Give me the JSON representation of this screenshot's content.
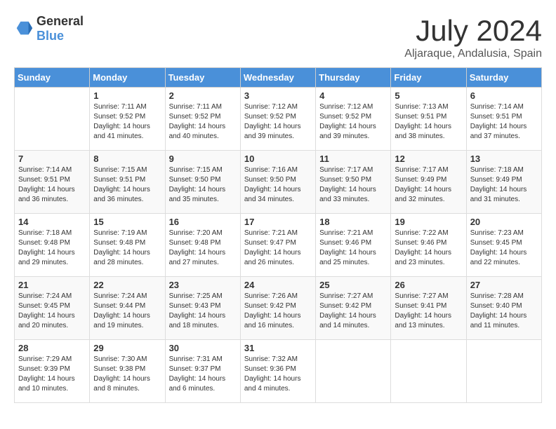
{
  "header": {
    "logo_general": "General",
    "logo_blue": "Blue",
    "month": "July 2024",
    "location": "Aljaraque, Andalusia, Spain"
  },
  "days_of_week": [
    "Sunday",
    "Monday",
    "Tuesday",
    "Wednesday",
    "Thursday",
    "Friday",
    "Saturday"
  ],
  "weeks": [
    [
      {
        "day": "",
        "sunrise": "",
        "sunset": "",
        "daylight": ""
      },
      {
        "day": "1",
        "sunrise": "Sunrise: 7:11 AM",
        "sunset": "Sunset: 9:52 PM",
        "daylight": "Daylight: 14 hours and 41 minutes."
      },
      {
        "day": "2",
        "sunrise": "Sunrise: 7:11 AM",
        "sunset": "Sunset: 9:52 PM",
        "daylight": "Daylight: 14 hours and 40 minutes."
      },
      {
        "day": "3",
        "sunrise": "Sunrise: 7:12 AM",
        "sunset": "Sunset: 9:52 PM",
        "daylight": "Daylight: 14 hours and 39 minutes."
      },
      {
        "day": "4",
        "sunrise": "Sunrise: 7:12 AM",
        "sunset": "Sunset: 9:52 PM",
        "daylight": "Daylight: 14 hours and 39 minutes."
      },
      {
        "day": "5",
        "sunrise": "Sunrise: 7:13 AM",
        "sunset": "Sunset: 9:51 PM",
        "daylight": "Daylight: 14 hours and 38 minutes."
      },
      {
        "day": "6",
        "sunrise": "Sunrise: 7:14 AM",
        "sunset": "Sunset: 9:51 PM",
        "daylight": "Daylight: 14 hours and 37 minutes."
      }
    ],
    [
      {
        "day": "7",
        "sunrise": "Sunrise: 7:14 AM",
        "sunset": "Sunset: 9:51 PM",
        "daylight": "Daylight: 14 hours and 36 minutes."
      },
      {
        "day": "8",
        "sunrise": "Sunrise: 7:15 AM",
        "sunset": "Sunset: 9:51 PM",
        "daylight": "Daylight: 14 hours and 36 minutes."
      },
      {
        "day": "9",
        "sunrise": "Sunrise: 7:15 AM",
        "sunset": "Sunset: 9:50 PM",
        "daylight": "Daylight: 14 hours and 35 minutes."
      },
      {
        "day": "10",
        "sunrise": "Sunrise: 7:16 AM",
        "sunset": "Sunset: 9:50 PM",
        "daylight": "Daylight: 14 hours and 34 minutes."
      },
      {
        "day": "11",
        "sunrise": "Sunrise: 7:17 AM",
        "sunset": "Sunset: 9:50 PM",
        "daylight": "Daylight: 14 hours and 33 minutes."
      },
      {
        "day": "12",
        "sunrise": "Sunrise: 7:17 AM",
        "sunset": "Sunset: 9:49 PM",
        "daylight": "Daylight: 14 hours and 32 minutes."
      },
      {
        "day": "13",
        "sunrise": "Sunrise: 7:18 AM",
        "sunset": "Sunset: 9:49 PM",
        "daylight": "Daylight: 14 hours and 31 minutes."
      }
    ],
    [
      {
        "day": "14",
        "sunrise": "Sunrise: 7:18 AM",
        "sunset": "Sunset: 9:48 PM",
        "daylight": "Daylight: 14 hours and 29 minutes."
      },
      {
        "day": "15",
        "sunrise": "Sunrise: 7:19 AM",
        "sunset": "Sunset: 9:48 PM",
        "daylight": "Daylight: 14 hours and 28 minutes."
      },
      {
        "day": "16",
        "sunrise": "Sunrise: 7:20 AM",
        "sunset": "Sunset: 9:48 PM",
        "daylight": "Daylight: 14 hours and 27 minutes."
      },
      {
        "day": "17",
        "sunrise": "Sunrise: 7:21 AM",
        "sunset": "Sunset: 9:47 PM",
        "daylight": "Daylight: 14 hours and 26 minutes."
      },
      {
        "day": "18",
        "sunrise": "Sunrise: 7:21 AM",
        "sunset": "Sunset: 9:46 PM",
        "daylight": "Daylight: 14 hours and 25 minutes."
      },
      {
        "day": "19",
        "sunrise": "Sunrise: 7:22 AM",
        "sunset": "Sunset: 9:46 PM",
        "daylight": "Daylight: 14 hours and 23 minutes."
      },
      {
        "day": "20",
        "sunrise": "Sunrise: 7:23 AM",
        "sunset": "Sunset: 9:45 PM",
        "daylight": "Daylight: 14 hours and 22 minutes."
      }
    ],
    [
      {
        "day": "21",
        "sunrise": "Sunrise: 7:24 AM",
        "sunset": "Sunset: 9:45 PM",
        "daylight": "Daylight: 14 hours and 20 minutes."
      },
      {
        "day": "22",
        "sunrise": "Sunrise: 7:24 AM",
        "sunset": "Sunset: 9:44 PM",
        "daylight": "Daylight: 14 hours and 19 minutes."
      },
      {
        "day": "23",
        "sunrise": "Sunrise: 7:25 AM",
        "sunset": "Sunset: 9:43 PM",
        "daylight": "Daylight: 14 hours and 18 minutes."
      },
      {
        "day": "24",
        "sunrise": "Sunrise: 7:26 AM",
        "sunset": "Sunset: 9:42 PM",
        "daylight": "Daylight: 14 hours and 16 minutes."
      },
      {
        "day": "25",
        "sunrise": "Sunrise: 7:27 AM",
        "sunset": "Sunset: 9:42 PM",
        "daylight": "Daylight: 14 hours and 14 minutes."
      },
      {
        "day": "26",
        "sunrise": "Sunrise: 7:27 AM",
        "sunset": "Sunset: 9:41 PM",
        "daylight": "Daylight: 14 hours and 13 minutes."
      },
      {
        "day": "27",
        "sunrise": "Sunrise: 7:28 AM",
        "sunset": "Sunset: 9:40 PM",
        "daylight": "Daylight: 14 hours and 11 minutes."
      }
    ],
    [
      {
        "day": "28",
        "sunrise": "Sunrise: 7:29 AM",
        "sunset": "Sunset: 9:39 PM",
        "daylight": "Daylight: 14 hours and 10 minutes."
      },
      {
        "day": "29",
        "sunrise": "Sunrise: 7:30 AM",
        "sunset": "Sunset: 9:38 PM",
        "daylight": "Daylight: 14 hours and 8 minutes."
      },
      {
        "day": "30",
        "sunrise": "Sunrise: 7:31 AM",
        "sunset": "Sunset: 9:37 PM",
        "daylight": "Daylight: 14 hours and 6 minutes."
      },
      {
        "day": "31",
        "sunrise": "Sunrise: 7:32 AM",
        "sunset": "Sunset: 9:36 PM",
        "daylight": "Daylight: 14 hours and 4 minutes."
      },
      {
        "day": "",
        "sunrise": "",
        "sunset": "",
        "daylight": ""
      },
      {
        "day": "",
        "sunrise": "",
        "sunset": "",
        "daylight": ""
      },
      {
        "day": "",
        "sunrise": "",
        "sunset": "",
        "daylight": ""
      }
    ]
  ]
}
